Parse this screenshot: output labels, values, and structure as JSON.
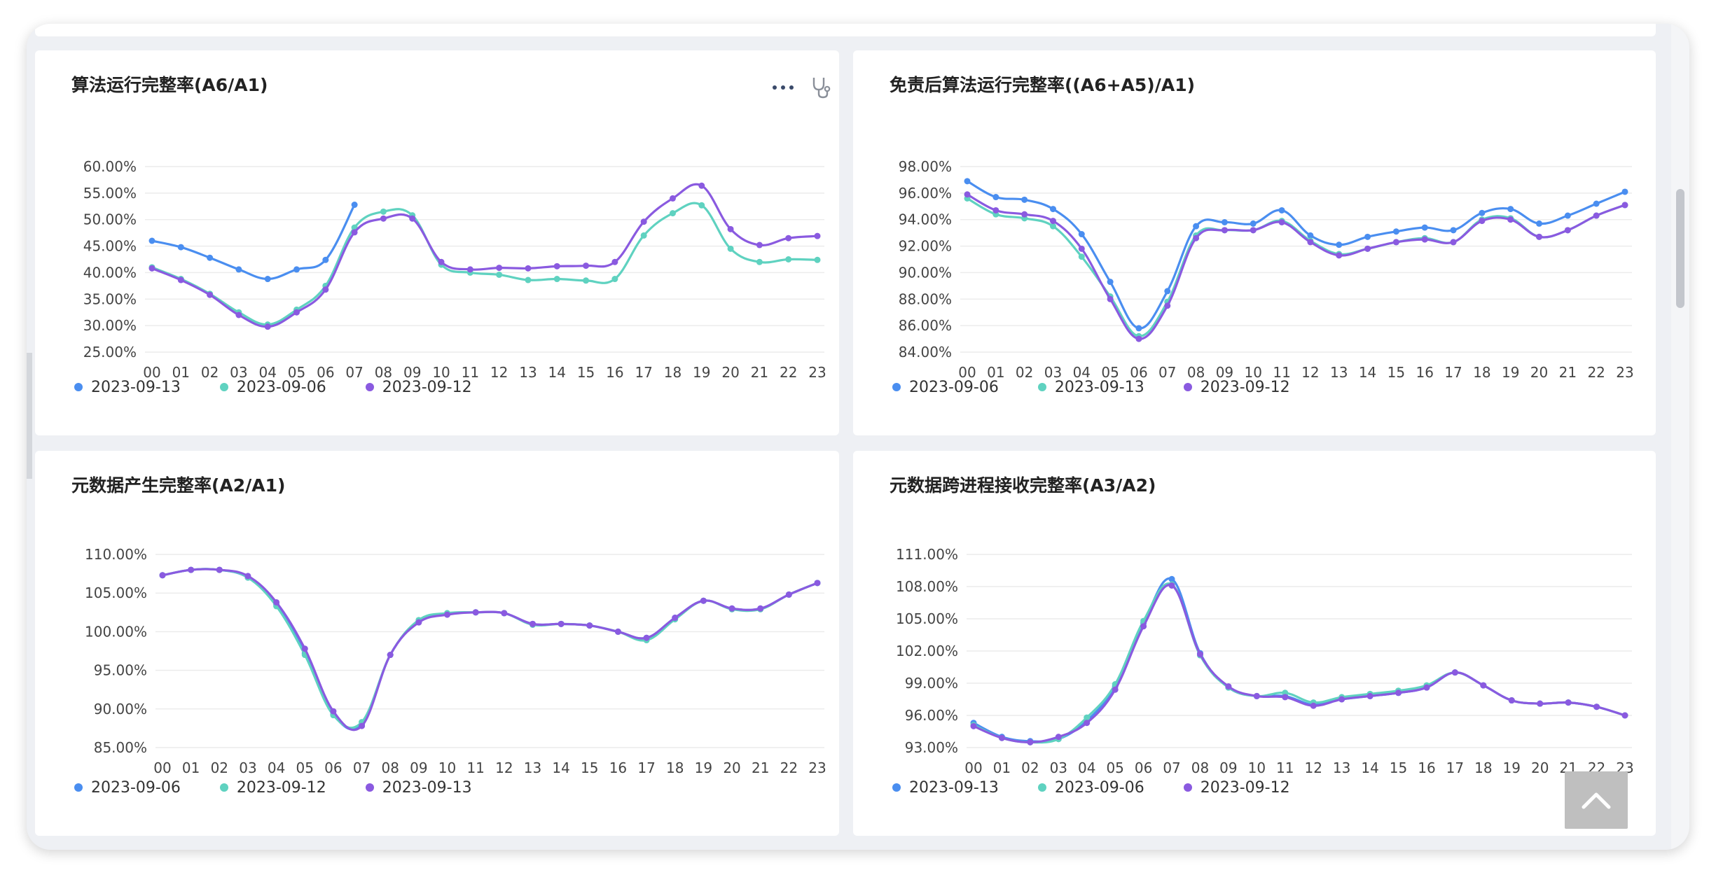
{
  "colors": {
    "blue": "#4a8ef0",
    "teal": "#5fd2c0",
    "purple": "#8a5ae0"
  },
  "toolbar_icons": [
    "more-dots-icon",
    "stethoscope-icon"
  ],
  "panels": [
    {
      "title": "算法运行完整率(A6/A1)",
      "legend": [
        {
          "label": "2023-09-13",
          "color": "#4a8ef0"
        },
        {
          "label": "2023-09-06",
          "color": "#5fd2c0"
        },
        {
          "label": "2023-09-12",
          "color": "#8a5ae0"
        }
      ],
      "chart_data": {
        "type": "line",
        "title": "算法运行完整率(A6/A1)",
        "x": [
          "00",
          "01",
          "02",
          "03",
          "04",
          "05",
          "06",
          "07",
          "08",
          "09",
          "10",
          "11",
          "12",
          "13",
          "14",
          "15",
          "16",
          "17",
          "18",
          "19",
          "20",
          "21",
          "22",
          "23"
        ],
        "yticks": [
          "25.00%",
          "30.00%",
          "35.00%",
          "40.00%",
          "45.00%",
          "50.00%",
          "55.00%",
          "60.00%"
        ],
        "ylim": [
          25,
          60
        ],
        "series": [
          {
            "name": "2023-09-13",
            "color": "#4a8ef0",
            "values": [
              46.0,
              44.8,
              42.8,
              40.6,
              38.8,
              40.6,
              42.4,
              52.8,
              null,
              null,
              null,
              null,
              null,
              null,
              null,
              null,
              null,
              null,
              null,
              null,
              null,
              null,
              null,
              null
            ]
          },
          {
            "name": "2023-09-06",
            "color": "#5fd2c0",
            "values": [
              41.0,
              38.8,
              36.0,
              32.5,
              30.2,
              33.0,
              37.5,
              48.5,
              51.5,
              50.8,
              41.5,
              40.0,
              39.6,
              38.6,
              38.8,
              38.5,
              38.8,
              47.0,
              51.2,
              52.7,
              44.5,
              42.0,
              42.5,
              42.4
            ]
          },
          {
            "name": "2023-09-12",
            "color": "#8a5ae0",
            "values": [
              40.8,
              38.6,
              35.8,
              32.0,
              29.8,
              32.5,
              36.8,
              47.6,
              50.2,
              50.2,
              42.0,
              40.6,
              40.9,
              40.8,
              41.2,
              41.3,
              42.0,
              49.6,
              54.0,
              56.4,
              48.2,
              45.2,
              46.5,
              46.9
            ]
          }
        ]
      }
    },
    {
      "title": "免责后算法运行完整率((A6+A5)/A1)",
      "legend": [
        {
          "label": "2023-09-06",
          "color": "#4a8ef0"
        },
        {
          "label": "2023-09-13",
          "color": "#5fd2c0"
        },
        {
          "label": "2023-09-12",
          "color": "#8a5ae0"
        }
      ],
      "chart_data": {
        "type": "line",
        "title": "免责后算法运行完整率((A6+A5)/A1)",
        "x": [
          "00",
          "01",
          "02",
          "03",
          "04",
          "05",
          "06",
          "07",
          "08",
          "09",
          "10",
          "11",
          "12",
          "13",
          "14",
          "15",
          "16",
          "17",
          "18",
          "19",
          "20",
          "21",
          "22",
          "23"
        ],
        "yticks": [
          "84.00%",
          "86.00%",
          "88.00%",
          "90.00%",
          "92.00%",
          "94.00%",
          "96.00%",
          "98.00%"
        ],
        "ylim": [
          84,
          98
        ],
        "series": [
          {
            "name": "2023-09-06",
            "color": "#4a8ef0",
            "values": [
              96.9,
              95.7,
              95.5,
              94.8,
              92.9,
              89.3,
              85.8,
              88.6,
              93.5,
              93.8,
              93.7,
              94.7,
              92.8,
              92.1,
              92.7,
              93.1,
              93.4,
              93.2,
              94.5,
              94.8,
              93.7,
              94.3,
              95.2,
              96.1
            ]
          },
          {
            "name": "2023-09-13",
            "color": "#5fd2c0",
            "values": [
              95.6,
              94.4,
              94.1,
              93.5,
              91.2,
              88.2,
              85.2,
              87.8,
              92.8,
              93.2,
              93.2,
              93.9,
              92.4,
              91.4,
              91.8,
              92.3,
              92.6,
              92.3,
              94.0,
              94.1,
              92.7,
              93.2,
              94.3,
              95.1
            ]
          },
          {
            "name": "2023-09-12",
            "color": "#8a5ae0",
            "values": [
              95.9,
              94.7,
              94.4,
              93.9,
              91.8,
              88.0,
              85.0,
              87.5,
              92.6,
              93.2,
              93.2,
              93.8,
              92.3,
              91.3,
              91.8,
              92.3,
              92.5,
              92.3,
              93.9,
              94.0,
              92.7,
              93.2,
              94.3,
              95.1
            ]
          }
        ]
      }
    },
    {
      "title": "元数据产生完整率(A2/A1)",
      "legend": [
        {
          "label": "2023-09-06",
          "color": "#4a8ef0"
        },
        {
          "label": "2023-09-12",
          "color": "#5fd2c0"
        },
        {
          "label": "2023-09-13",
          "color": "#8a5ae0"
        }
      ],
      "chart_data": {
        "type": "line",
        "title": "元数据产生完整率(A2/A1)",
        "x": [
          "00",
          "01",
          "02",
          "03",
          "04",
          "05",
          "06",
          "07",
          "08",
          "09",
          "10",
          "11",
          "12",
          "13",
          "14",
          "15",
          "16",
          "17",
          "18",
          "19",
          "20",
          "21",
          "22",
          "23"
        ],
        "yticks": [
          "85.00%",
          "90.00%",
          "95.00%",
          "100.00%",
          "105.00%",
          "110.00%"
        ],
        "ylim": [
          85,
          110
        ],
        "series": [
          {
            "name": "2023-09-06",
            "color": "#4a8ef0",
            "values": [
              107.3,
              108.0,
              108.0,
              107.0,
              103.5,
              97.2,
              89.3,
              88.0,
              97.0,
              101.3,
              102.3,
              102.5,
              102.4,
              101.0,
              101.0,
              100.8,
              100.0,
              99.2,
              101.8,
              104.0,
              103.0,
              103.0,
              104.8,
              106.3
            ]
          },
          {
            "name": "2023-09-12",
            "color": "#5fd2c0",
            "values": [
              107.3,
              108.0,
              108.0,
              107.0,
              103.3,
              97.0,
              89.2,
              88.3,
              97.0,
              101.5,
              102.4,
              102.5,
              102.4,
              100.9,
              101.0,
              100.8,
              100.0,
              98.9,
              101.6,
              104.0,
              102.9,
              102.9,
              104.8,
              106.3
            ]
          },
          {
            "name": "2023-09-13",
            "color": "#8a5ae0",
            "values": [
              107.3,
              108.0,
              108.0,
              107.2,
              103.8,
              97.8,
              89.7,
              87.8,
              97.0,
              101.2,
              102.2,
              102.5,
              102.4,
              101.0,
              101.0,
              100.8,
              100.0,
              99.2,
              101.8,
              104.0,
              103.0,
              103.0,
              104.8,
              106.3
            ]
          }
        ]
      }
    },
    {
      "title": "元数据跨进程接收完整率(A3/A2)",
      "legend": [
        {
          "label": "2023-09-13",
          "color": "#4a8ef0"
        },
        {
          "label": "2023-09-06",
          "color": "#5fd2c0"
        },
        {
          "label": "2023-09-12",
          "color": "#8a5ae0"
        }
      ],
      "chart_data": {
        "type": "line",
        "title": "元数据跨进程接收完整率(A3/A2)",
        "x": [
          "00",
          "01",
          "02",
          "03",
          "04",
          "05",
          "06",
          "07",
          "08",
          "09",
          "10",
          "11",
          "12",
          "13",
          "14",
          "15",
          "16",
          "17",
          "18",
          "19",
          "20",
          "21",
          "22",
          "23"
        ],
        "yticks": [
          "93.00%",
          "96.00%",
          "99.00%",
          "102.00%",
          "105.00%",
          "108.00%",
          "111.00%"
        ],
        "ylim": [
          93,
          111
        ],
        "series": [
          {
            "name": "2023-09-13",
            "color": "#4a8ef0",
            "values": [
              95.3,
              94.0,
              93.6,
              93.8,
              95.5,
              98.7,
              104.6,
              108.7,
              101.8,
              98.6,
              97.8,
              97.8,
              97.0,
              97.5,
              97.8,
              98.1,
              98.6,
              100.0,
              98.8,
              97.4,
              97.1,
              97.2,
              96.8,
              96.0
            ]
          },
          {
            "name": "2023-09-06",
            "color": "#5fd2c0",
            "values": [
              95.1,
              93.9,
              93.5,
              93.8,
              95.8,
              98.9,
              104.8,
              108.2,
              101.6,
              98.6,
              97.8,
              98.1,
              97.2,
              97.7,
              98.0,
              98.3,
              98.8,
              100.0,
              98.8,
              97.4,
              97.1,
              97.2,
              96.8,
              96.0
            ]
          },
          {
            "name": "2023-09-12",
            "color": "#8a5ae0",
            "values": [
              95.0,
              93.9,
              93.5,
              94.0,
              95.3,
              98.4,
              104.3,
              108.1,
              101.7,
              98.7,
              97.8,
              97.7,
              96.9,
              97.5,
              97.8,
              98.1,
              98.6,
              100.0,
              98.8,
              97.4,
              97.1,
              97.2,
              96.8,
              96.0
            ]
          }
        ]
      }
    }
  ]
}
